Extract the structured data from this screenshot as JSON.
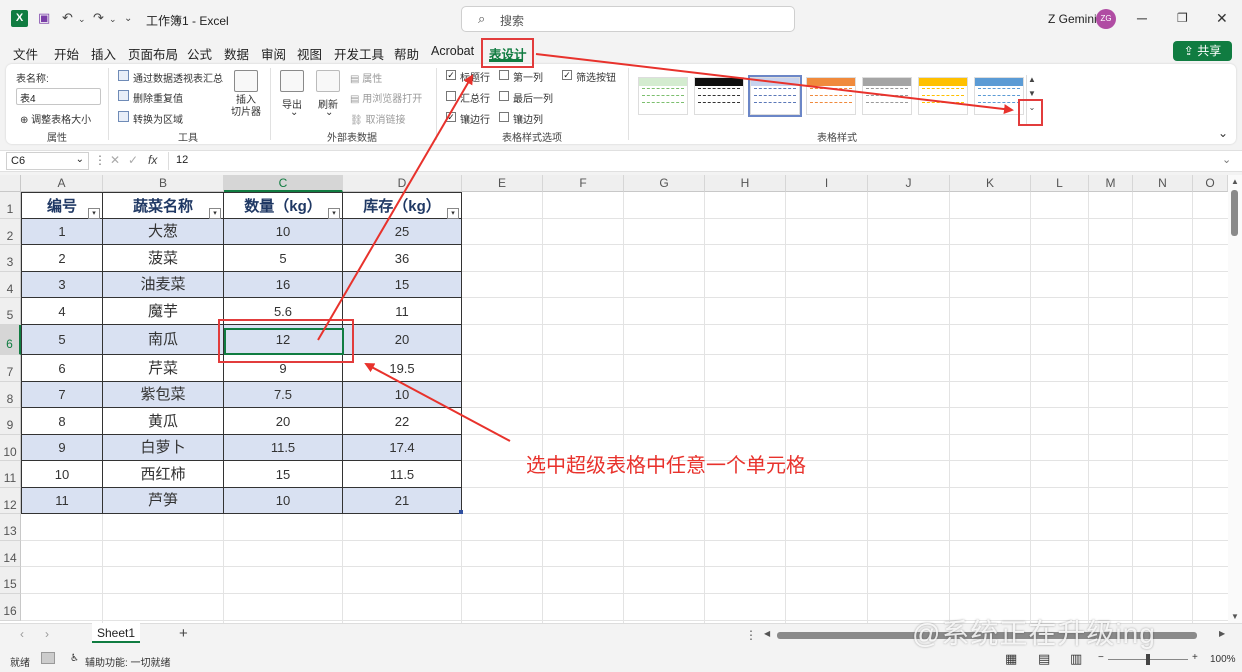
{
  "titlebar": {
    "logo": "X",
    "title": "工作簿1 - Excel",
    "search_placeholder": "搜索",
    "user_name": "Z Gemini",
    "user_initials": "ZG"
  },
  "tabs": [
    "文件",
    "开始",
    "插入",
    "页面布局",
    "公式",
    "数据",
    "审阅",
    "视图",
    "开发工具",
    "帮助",
    "Acrobat",
    "表设计"
  ],
  "active_tab": "表设计",
  "share_label": "共享",
  "ribbon": {
    "properties": {
      "table_name_label": "表名称:",
      "table_name_value": "表4",
      "resize_label": "调整表格大小",
      "group": "属性"
    },
    "tools": {
      "pivot": "通过数据透视表汇总",
      "remove_dup": "删除重复值",
      "convert": "转换为区域",
      "slicer": "插入\n切片器",
      "group": "工具"
    },
    "external": {
      "export": "导出",
      "refresh": "刷新",
      "props": "属性",
      "open_browser": "用浏览器打开",
      "unlink": "取消链接",
      "group": "外部表数据"
    },
    "style_options": {
      "header_row": "标题行",
      "total_row": "汇总行",
      "banded_rows": "镶边行",
      "first_col": "第一列",
      "last_col": "最后一列",
      "banded_cols": "镶边列",
      "filter_btn": "筛选按钮",
      "group": "表格样式选项"
    },
    "table_styles": {
      "group": "表格样式"
    }
  },
  "formula_bar": {
    "name_box": "C6",
    "fx": "fx",
    "value": "12"
  },
  "columns": [
    "A",
    "B",
    "C",
    "D",
    "E",
    "F",
    "G",
    "H",
    "I",
    "J",
    "K",
    "L",
    "M",
    "N",
    "O"
  ],
  "rows": [
    "1",
    "2",
    "3",
    "4",
    "5",
    "6",
    "7",
    "8",
    "9",
    "10",
    "11",
    "12",
    "13",
    "14",
    "15",
    "16"
  ],
  "table": {
    "headers": [
      "编号",
      "蔬菜名称",
      "数量（kg）",
      "库存（kg）"
    ],
    "rows": [
      [
        "1",
        "大葱",
        "10",
        "25"
      ],
      [
        "2",
        "菠菜",
        "5",
        "36"
      ],
      [
        "3",
        "油麦菜",
        "16",
        "15"
      ],
      [
        "4",
        "魔芋",
        "5.6",
        "11"
      ],
      [
        "5",
        "南瓜",
        "12",
        "20"
      ],
      [
        "6",
        "芹菜",
        "9",
        "19.5"
      ],
      [
        "7",
        "紫包菜",
        "7.5",
        "10"
      ],
      [
        "8",
        "黄瓜",
        "20",
        "22"
      ],
      [
        "9",
        "白萝卜",
        "11.5",
        "17.4"
      ],
      [
        "10",
        "西红柿",
        "15",
        "11.5"
      ],
      [
        "11",
        "芦笋",
        "10",
        "21"
      ]
    ]
  },
  "sheet_tab": "Sheet1",
  "add_sheet": "+",
  "status": {
    "ready": "就绪",
    "accessibility": "辅助功能: 一切就绪",
    "zoom": "100%"
  },
  "annotation": "选中超级表格中任意一个单元格",
  "watermark": "@系统正在升级ing",
  "colors": {
    "accent": "#107c41",
    "band": "#d9e1f2",
    "annotation": "#e8322c"
  }
}
